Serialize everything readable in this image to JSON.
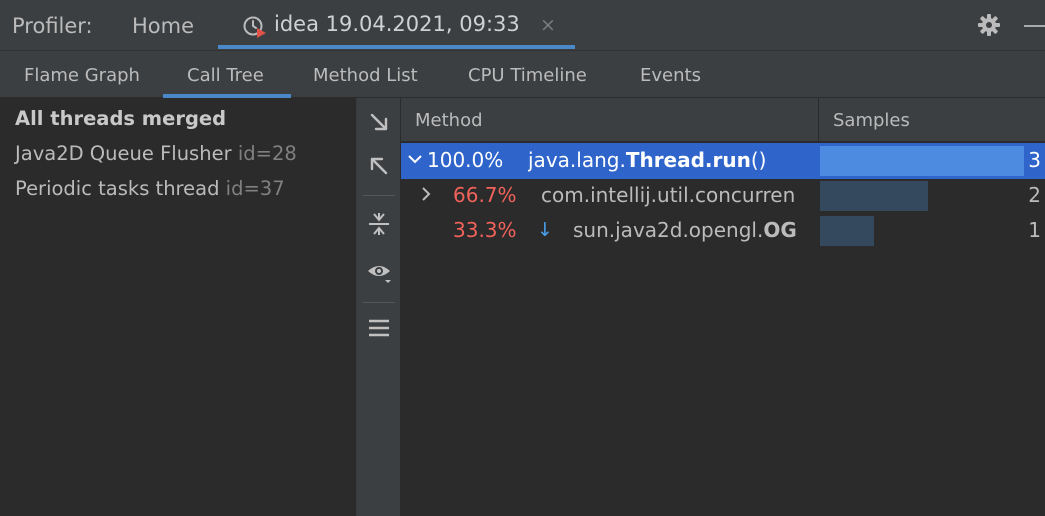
{
  "header": {
    "profiler_label": "Profiler:",
    "home_tab": "Home",
    "session_tab": "idea 19.04.2021, 09:33",
    "close_symbol": "×",
    "gear_icon": "gear-icon",
    "minimize_icon": "minimize-icon"
  },
  "subtabs": [
    {
      "label": "Flame Graph",
      "active": false
    },
    {
      "label": "Call Tree",
      "active": true
    },
    {
      "label": "Method List",
      "active": false
    },
    {
      "label": "CPU Timeline",
      "active": false
    },
    {
      "label": "Events",
      "active": false
    }
  ],
  "threads": [
    {
      "name": "All threads merged",
      "id": "",
      "bold": true
    },
    {
      "name": "Java2D Queue Flusher",
      "id": "id=28",
      "bold": false
    },
    {
      "name": "Periodic tasks thread",
      "id": "id=37",
      "bold": false
    }
  ],
  "toolbar": [
    "expand-arrow-icon",
    "collapse-arrow-icon",
    "merge-vertical-icon",
    "eye-icon",
    "menu-icon"
  ],
  "table": {
    "col_method": "Method",
    "col_samples": "Samples",
    "rows": [
      {
        "percent": "100.0%",
        "method_prefix": "java.lang.",
        "method_bold": "Thread.run",
        "method_suffix": "()",
        "samples": "3",
        "fraction": 1.0,
        "selected": true,
        "expanded": true
      },
      {
        "percent": "66.7%",
        "method_prefix": "com.intellij.util.concurren",
        "method_bold": "",
        "method_suffix": "",
        "samples": "2",
        "fraction": 0.667,
        "selected": false,
        "expanded": false
      },
      {
        "percent": "33.3%",
        "method_prefix": "sun.java2d.opengl.",
        "method_bold": "OG",
        "method_suffix": "",
        "samples": "1",
        "fraction": 0.333,
        "selected": false,
        "leaf_arrow": "↓"
      }
    ]
  },
  "colors": {
    "accent": "#4a88c7",
    "selection": "#2f65ca",
    "percent_red": "#f0625a",
    "bar_selected": "#4d8be0",
    "bar_normal": "#34485e"
  }
}
